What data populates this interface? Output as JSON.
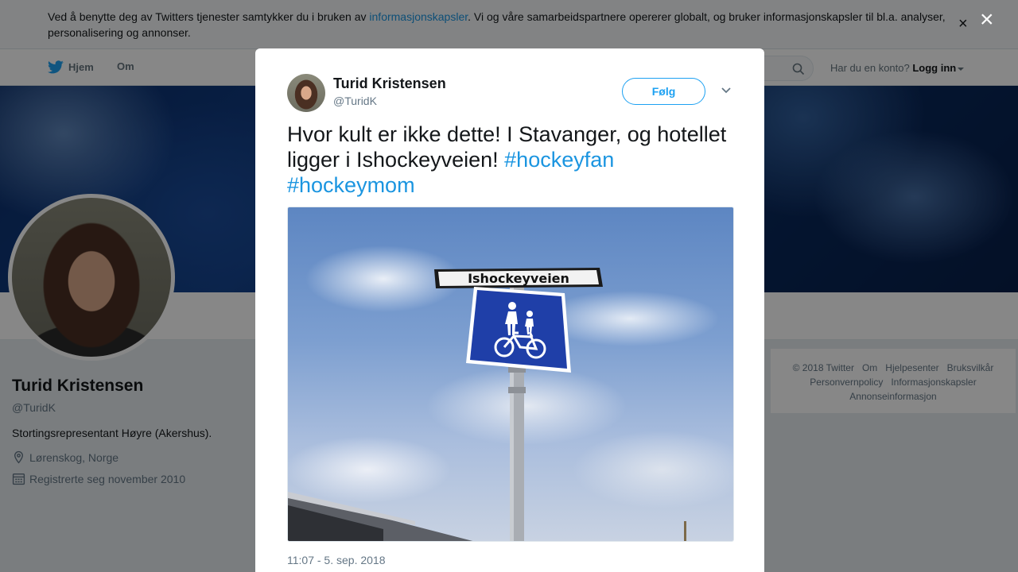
{
  "cookie_banner": {
    "text_before_link": "Ved å benytte deg av Twitters tjenester samtykker du i bruken av ",
    "link_text": "informasjonskapsler",
    "text_after_link": ". Vi og våre samarbeidspartnere opererer globalt, og bruker informasjonskapsler til bl.a. analyser, personalisering og annonser.",
    "close_symbol": "×"
  },
  "nav": {
    "home": "Hjem",
    "about": "Om",
    "account_prompt": "Har du en konto?",
    "login": "Logg inn"
  },
  "profile": {
    "name": "Turid Kristensen",
    "handle": "@TuridK",
    "bio": "Stortingsrepresentant Høyre (Akershus).",
    "location": "Lørenskog, Norge",
    "joined": "Registrerte seg november 2010"
  },
  "footer": {
    "links": [
      "© 2018 Twitter",
      "Om",
      "Hjelpesenter",
      "Bruksvilkår",
      "Personvernpolicy",
      "Informasjonskapsler",
      "Annonseinformasjon"
    ]
  },
  "overlay": {
    "close_symbol": "×"
  },
  "tweet": {
    "author_name": "Turid Kristensen",
    "author_handle": "@TuridK",
    "follow_label": "Følg",
    "text": "Hvor kult er ikke dette! I Stavanger, og hotellet ligger i Ishockeyveien!",
    "hashtags": [
      "#hockeyfan",
      "#hockeymom"
    ],
    "photo_sign_text": "Ishockeyveien",
    "timestamp": "11:07 - 5. sep. 2018"
  },
  "colors": {
    "link": "#1b95e0",
    "follow": "#1da1f2",
    "sign_blue": "#1f3fa8"
  }
}
